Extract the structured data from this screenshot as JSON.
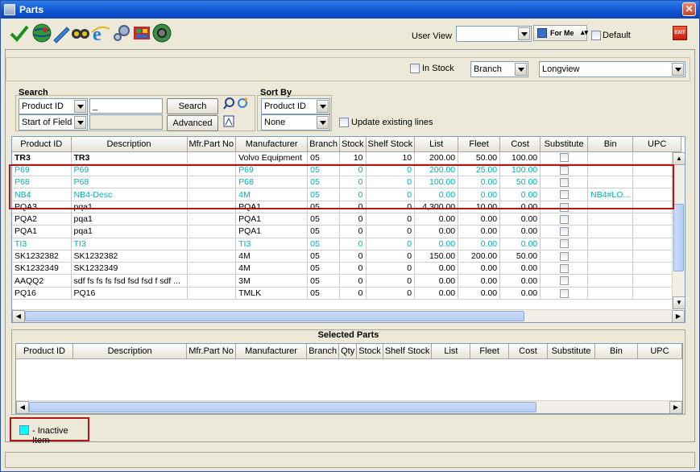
{
  "window": {
    "title": "Parts",
    "close_glyph": "✕"
  },
  "toolbar": {
    "icons": [
      "checkmark-icon",
      "globe-icon",
      "edit-pencil-icon",
      "binoculars-icon",
      "browser-e-icon",
      "gears-icon",
      "inventory-icon",
      "world-gears-icon"
    ],
    "user_view_label": "User View",
    "user_view_value": "",
    "for_me_label": "For Me",
    "default_label": "Default",
    "exit_label": "EXIT"
  },
  "filters": {
    "in_stock_label": "In Stock",
    "branch_value": "Branch",
    "view_value": "Longview"
  },
  "search": {
    "title": "Search",
    "field_value": "Product ID",
    "mode_value": "Start of Field",
    "query_value": "_",
    "search_button": "Search",
    "advanced_button": "Advanced"
  },
  "sort": {
    "title": "Sort By",
    "primary_value": "Product ID",
    "secondary_value": "None",
    "update_label": "Update existing lines"
  },
  "parts_grid": {
    "columns": [
      "Product ID",
      "Description",
      "Mfr.Part No",
      "Manufacturer",
      "Branch",
      "Stock",
      "Shelf Stock",
      "List",
      "Fleet",
      "Cost",
      "Substitute",
      "Bin",
      "UPC"
    ],
    "rows": [
      {
        "id": "TR3",
        "desc": "TR3",
        "mfr": "",
        "manufacturer": "Volvo Equipment",
        "branch": "05",
        "stock": "10",
        "shelf": "10",
        "list": "200.00",
        "fleet": "50.00",
        "cost": "100.00",
        "bin": "",
        "inactive": false
      },
      {
        "id": "P69",
        "desc": "P69",
        "mfr": "",
        "manufacturer": "P69",
        "branch": "05",
        "stock": "0",
        "shelf": "0",
        "list": "200.00",
        "fleet": "25.00",
        "cost": "100.00",
        "bin": "",
        "inactive": true
      },
      {
        "id": "P68",
        "desc": "P68",
        "mfr": "",
        "manufacturer": "P68",
        "branch": "05",
        "stock": "0",
        "shelf": "0",
        "list": "100.00",
        "fleet": "0.00",
        "cost": "50.00",
        "bin": "",
        "inactive": true
      },
      {
        "id": "NB4",
        "desc": "NB4-Desc",
        "mfr": "",
        "manufacturer": "4M",
        "branch": "05",
        "stock": "0",
        "shelf": "0",
        "list": "0.00",
        "fleet": "0.00",
        "cost": "0.00",
        "bin": "NB4#LO...",
        "inactive": true
      },
      {
        "id": "PQA3",
        "desc": "pqa1",
        "mfr": "",
        "manufacturer": "PQA1",
        "branch": "05",
        "stock": "0",
        "shelf": "0",
        "list": "4,300.00",
        "fleet": "10.00",
        "cost": "0.00",
        "bin": "",
        "inactive": false
      },
      {
        "id": "PQA2",
        "desc": "pqa1",
        "mfr": "",
        "manufacturer": "PQA1",
        "branch": "05",
        "stock": "0",
        "shelf": "0",
        "list": "0.00",
        "fleet": "0.00",
        "cost": "0.00",
        "bin": "",
        "inactive": false
      },
      {
        "id": "PQA1",
        "desc": "pqa1",
        "mfr": "",
        "manufacturer": "PQA1",
        "branch": "05",
        "stock": "0",
        "shelf": "0",
        "list": "0.00",
        "fleet": "0.00",
        "cost": "0.00",
        "bin": "",
        "inactive": false
      },
      {
        "id": "TI3",
        "desc": "TI3",
        "mfr": "",
        "manufacturer": "TI3",
        "branch": "05",
        "stock": "0",
        "shelf": "0",
        "list": "0.00",
        "fleet": "0.00",
        "cost": "0.00",
        "bin": "",
        "inactive": true
      },
      {
        "id": "SK1232382",
        "desc": "SK1232382",
        "mfr": "",
        "manufacturer": "4M",
        "branch": "05",
        "stock": "0",
        "shelf": "0",
        "list": "150.00",
        "fleet": "200.00",
        "cost": "50.00",
        "bin": "",
        "inactive": false
      },
      {
        "id": "SK1232349",
        "desc": "SK1232349",
        "mfr": "",
        "manufacturer": "4M",
        "branch": "05",
        "stock": "0",
        "shelf": "0",
        "list": "0.00",
        "fleet": "0.00",
        "cost": "0.00",
        "bin": "",
        "inactive": false
      },
      {
        "id": "AAQQ2",
        "desc": "sdf fs fs fs fsd fsd fsd f sdf ...",
        "mfr": "",
        "manufacturer": "3M",
        "branch": "05",
        "stock": "0",
        "shelf": "0",
        "list": "0.00",
        "fleet": "0.00",
        "cost": "0.00",
        "bin": "",
        "inactive": false
      },
      {
        "id": "PQ16",
        "desc": "PQ16",
        "mfr": "",
        "manufacturer": "TMLK",
        "branch": "05",
        "stock": "0",
        "shelf": "0",
        "list": "0.00",
        "fleet": "0.00",
        "cost": "0.00",
        "bin": "",
        "inactive": false
      }
    ]
  },
  "selected_parts": {
    "title": "Selected Parts",
    "columns": [
      "Product ID",
      "Description",
      "Mfr.Part No",
      "Manufacturer",
      "Branch",
      "Qty",
      "Stock",
      "Shelf Stock",
      "List",
      "Fleet",
      "Cost",
      "Substitute",
      "Bin",
      "UPC"
    ]
  },
  "legend": {
    "label": "- Inactive Item",
    "color": "#00ffff"
  },
  "colors": {
    "inactive_text": "#00b3b3",
    "highlight": "#b01818",
    "title_bar": "#1256d4"
  }
}
